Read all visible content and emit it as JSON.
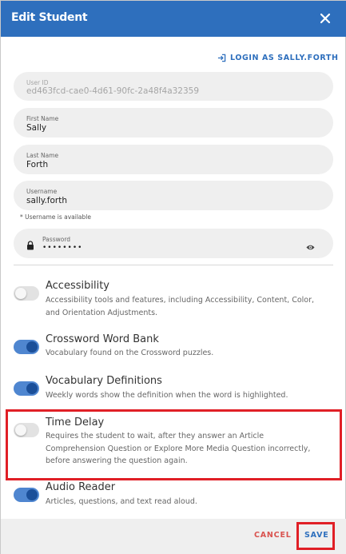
{
  "header": {
    "title": "Edit Student"
  },
  "login_link": {
    "label": "LOGIN AS SALLY.FORTH"
  },
  "fields": {
    "user_id": {
      "label": "User ID",
      "value": "ed463fcd-cae0-4d61-90fc-2a48f4a32359"
    },
    "first_name": {
      "label": "First Name",
      "value": "Sally"
    },
    "last_name": {
      "label": "Last Name",
      "value": "Forth"
    },
    "username": {
      "label": "Username",
      "value": "sally.forth",
      "hint": "* Username is available"
    },
    "password": {
      "label": "Password",
      "value": "••••••••"
    }
  },
  "options": [
    {
      "title": "Accessibility",
      "desc": "Accessibility tools and features, including Accessibility, Content, Color, and Orientation Adjustments.",
      "enabled": false
    },
    {
      "title": "Crossword Word Bank",
      "desc": "Vocabulary found on the Crossword puzzles.",
      "enabled": true
    },
    {
      "title": "Vocabulary Definitions",
      "desc": "Weekly words show the definition when the word is highlighted.",
      "enabled": true
    },
    {
      "title": "Time Delay",
      "desc": "Requires the student to wait, after they answer an Article Comprehension Question or Explore More Media Question incorrectly, before answering the question again.",
      "enabled": false
    },
    {
      "title": "Audio Reader",
      "desc": "Articles, questions, and text read aloud.",
      "enabled": true
    }
  ],
  "footer": {
    "cancel_label": "CANCEL",
    "save_label": "SAVE"
  },
  "colors": {
    "header": "#2e6fbd",
    "toggle_on": "#4f86d0",
    "cancel": "#d9534f",
    "highlight": "#e01f26"
  },
  "icons": {
    "close": "close-icon",
    "login": "login-icon",
    "lock": "lock-icon",
    "eye": "eye-icon"
  }
}
